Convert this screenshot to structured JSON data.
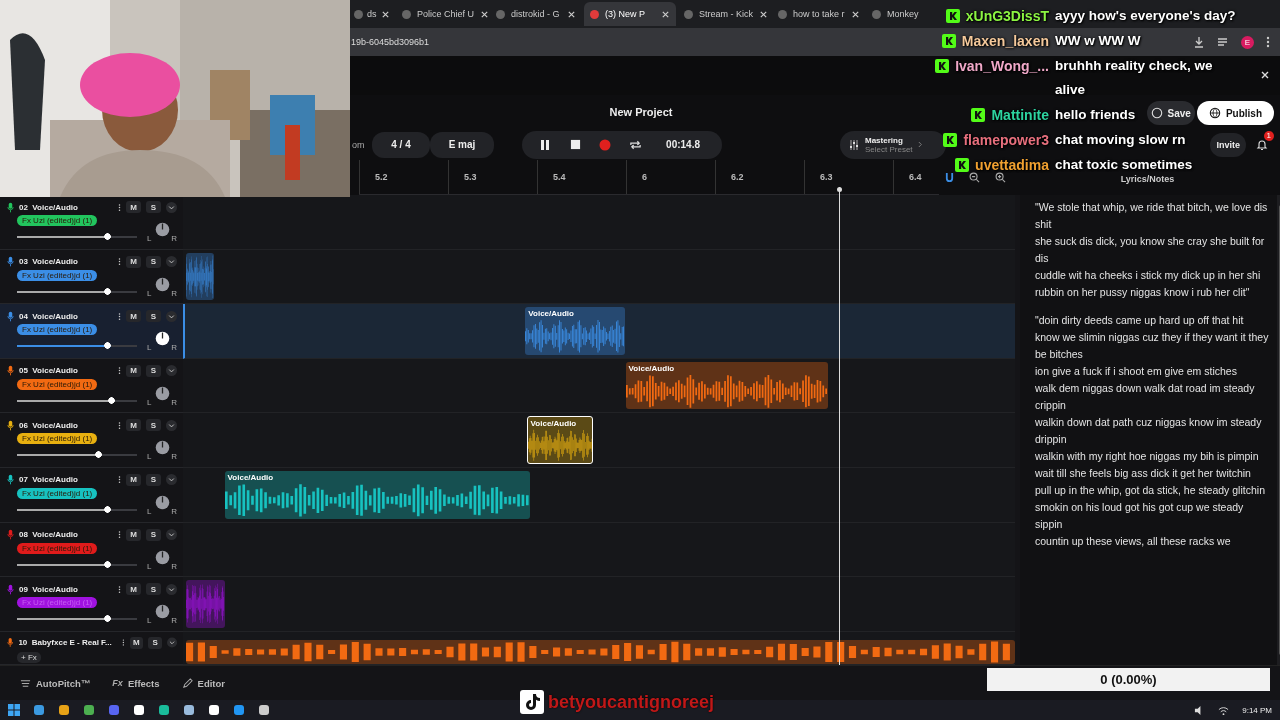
{
  "browser": {
    "tabs": [
      {
        "title": "ds",
        "selected": false,
        "closable": true
      },
      {
        "title": "Police Chief U",
        "selected": false,
        "closable": true
      },
      {
        "title": "distrokid - G",
        "selected": false,
        "closable": true
      },
      {
        "title": "(3) New P",
        "selected": true,
        "closable": true
      },
      {
        "title": "Stream - Kick",
        "selected": false,
        "closable": true
      },
      {
        "title": "how to take r",
        "selected": false,
        "closable": true
      },
      {
        "title": "Monkey",
        "selected": false,
        "closable": false
      }
    ],
    "address": "19b-6045bd3096b1",
    "avatar": "E"
  },
  "chat": [
    {
      "user": "xUnG3DissT",
      "color": "#8cf542",
      "message": "ayyy how's everyone's day?"
    },
    {
      "user": "Maxen_laxen",
      "color": "#f5c99b",
      "message": "WW w WW W"
    },
    {
      "user": "Ivan_Wong_...",
      "color": "#f0a8c8",
      "message": "bruhhh reality check, we alive"
    },
    {
      "user": "Mattinite",
      "color": "#2dd4a0",
      "message": "hello friends"
    },
    {
      "user": "flamepower3",
      "color": "#e8707e",
      "message": "chat moving slow rn"
    },
    {
      "user": "uvettadima",
      "color": "#f0a030",
      "message": "chat toxic sometimes"
    }
  ],
  "project": {
    "title": "New Project",
    "save": "Save",
    "publish": "Publish",
    "invite": "Invite",
    "notifications": "1",
    "prefix": "om",
    "meter": "4 / 4",
    "key": "E maj",
    "playing": true,
    "time": "00:14.8",
    "mastering": "Mastering",
    "preset": "Select Preset"
  },
  "ruler": {
    "ticks": [
      "5.2",
      "5.3",
      "5.4",
      "6",
      "6.2",
      "6.3",
      "6.4"
    ],
    "panel_title": "Lyrics/Notes"
  },
  "tracks": [
    {
      "kind": "full",
      "number": "02",
      "name": "Voice/Audio",
      "fx": "Fx Uzi (edited)jd (1)",
      "color": "#22c55e",
      "level": 0.78,
      "selected": false,
      "mute": "M",
      "solo": "S",
      "pan": [
        "L",
        "R"
      ]
    },
    {
      "kind": "full",
      "number": "03",
      "name": "Voice/Audio",
      "fx": "Fx Uzi (edited)jd (1)",
      "color": "#3b8ee6",
      "level": 0.78,
      "selected": false,
      "mute": "M",
      "solo": "S",
      "pan": [
        "L",
        "R"
      ],
      "clip": {
        "selected": false
      }
    },
    {
      "kind": "full",
      "number": "04",
      "name": "Voice/Audio",
      "fx": "Fx Uzi (edited)jd (1)",
      "color": "#3b8ee6",
      "level": 0.78,
      "selected": true,
      "mute": "M",
      "solo": "S",
      "pan": [
        "L",
        "R"
      ],
      "clip": {
        "label": "Voice/Audio",
        "selected": false
      }
    },
    {
      "kind": "full",
      "number": "05",
      "name": "Voice/Audio",
      "fx": "Fx Uzi (edited)jd (1)",
      "color": "#f26a12",
      "level": 0.82,
      "selected": false,
      "mute": "M",
      "solo": "S",
      "pan": [
        "L",
        "R"
      ],
      "clip": {
        "label": "Voice/Audio",
        "selected": false
      }
    },
    {
      "kind": "full",
      "number": "06",
      "name": "Voice/Audio",
      "fx": "Fx Uzi (edited)jd (1)",
      "color": "#e8b010",
      "level": 0.71,
      "selected": false,
      "mute": "M",
      "solo": "S",
      "pan": [
        "L",
        "R"
      ],
      "clip": {
        "label": "Voice/Audio",
        "selected": true
      }
    },
    {
      "kind": "full",
      "number": "07",
      "name": "Voice/Audio",
      "fx": "Fx Uzi (edited)jd (1)",
      "color": "#17c2c0",
      "level": 0.78,
      "selected": false,
      "mute": "M",
      "solo": "S",
      "pan": [
        "L",
        "R"
      ],
      "clip": {
        "label": "Voice/Audio",
        "selected": false
      }
    },
    {
      "kind": "full",
      "number": "08",
      "name": "Voice/Audio",
      "fx": "Fx Uzi (edited)jd (1)",
      "color": "#e01b1b",
      "level": 0.78,
      "selected": false,
      "mute": "M",
      "solo": "S",
      "pan": [
        "L",
        "R"
      ]
    },
    {
      "kind": "full",
      "number": "09",
      "name": "Voice/Audio",
      "fx": "Fx Uzi (edited)jd (1)",
      "color": "#a012e0",
      "level": 0.78,
      "selected": false,
      "mute": "M",
      "solo": "S",
      "pan": [
        "L",
        "R"
      ],
      "clip": {
        "selected": false
      }
    },
    {
      "kind": "compact",
      "number": "10",
      "name": "Babyfxce E - Real F...",
      "fx_button": "+ Fx",
      "color": "#f26a12",
      "selected": false,
      "mute": "M",
      "solo": "S",
      "clip": {
        "selected": false
      }
    }
  ],
  "lyrics": [
    [
      "\"We stole that whip, we ride that bitch, we love dis shit",
      "she suck dis dick, you know she cray she built for dis",
      "cuddle wit ha cheeks i stick my dick up in her shi",
      "rubbin on her pussy niggas know i rub her clit\""
    ],
    [
      "\"doin dirty deeds came up hard up off that hit",
      "know we slimin niggas cuz they if they want it they be bitches",
      "ion give a fuck if i shoot em give em stiches",
      "walk dem niggas down walk dat road im steady crippin",
      "walkin down dat path cuz niggas know im steady drippin",
      "walkin with my right hoe niggas my bih is pimpin",
      "wait till she feels big ass dick it get her twitchin",
      "pull up in the whip, got da stick, he steady glitchin",
      "smokin on his loud got his got cup we steady sippin",
      "countin up these views, all these racks we"
    ]
  ],
  "bottom_tools": [
    {
      "kind": "autopitch",
      "label": "AutoPitch™"
    },
    {
      "kind": "effects",
      "glyph": "Fx",
      "label": "Effects"
    },
    {
      "kind": "editor",
      "label": "Editor"
    }
  ],
  "overlay": {
    "counter": "0 (0.00%)",
    "handle": "betyoucantignoreej"
  },
  "taskbar": {
    "clock": "9:14 PM"
  }
}
